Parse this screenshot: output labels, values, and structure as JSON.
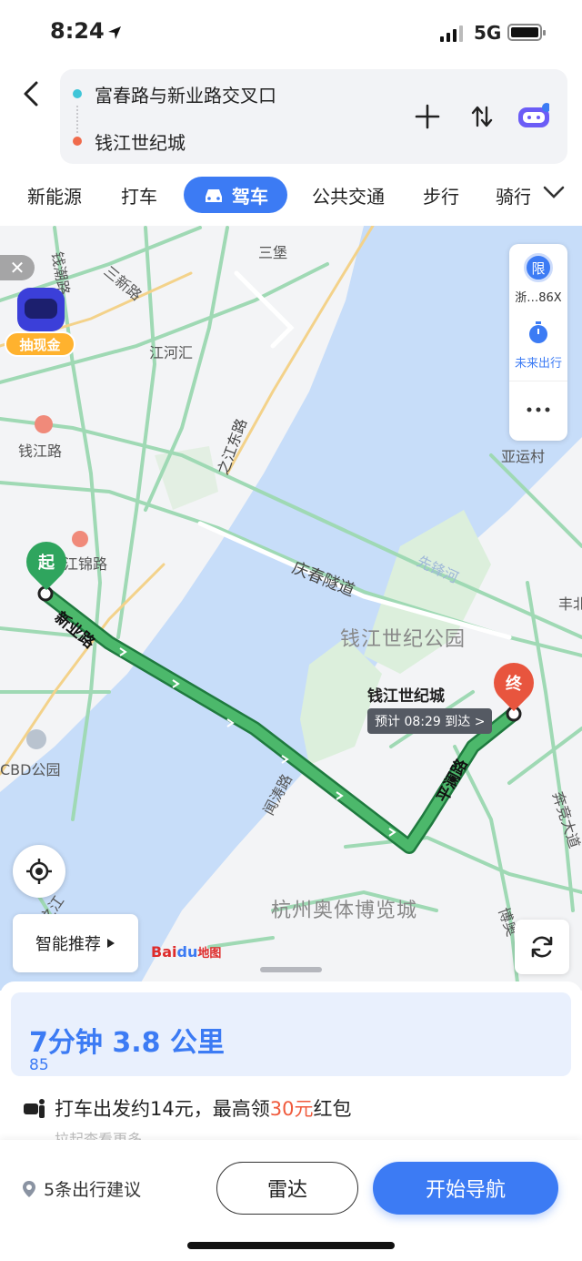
{
  "status_bar": {
    "time": "8:24",
    "network": "5G"
  },
  "route": {
    "from": "富春路与新业路交叉口",
    "to": "钱江世纪城"
  },
  "tabs": [
    "新能源",
    "打车",
    "驾车",
    "公共交通",
    "步行",
    "骑行"
  ],
  "map": {
    "labels": {
      "sanbao": "三堡",
      "sanxin": "三新路",
      "qianchao": "钱潮路",
      "jianghehui": "江河汇",
      "qianjianglu": "钱江路",
      "zhijiangdonglu": "之江东路",
      "yayuncun": "亚运村",
      "jinjinlu": "江锦路",
      "qingchun_tunnel": "庆春隧道",
      "xianfenghe": "先锋河",
      "park": "钱江世纪公园",
      "cbd_park": "CBD公园",
      "wentaolu": "闻涛路",
      "expo": "杭州奥体博览城",
      "fengbei": "丰北",
      "qingyundadao": "奔竞大道",
      "bowen": "博奥",
      "xinyelu": "新业路",
      "pinglanlu": "平澜路",
      "zhi": "之江"
    },
    "start_label": "起",
    "end_label": "终",
    "destination": "钱江世纪城",
    "eta": "预计 08:29 到达 >",
    "plate": "浙…86X",
    "limit": "限",
    "future_label": "未来出行",
    "promo_badge": "抽现金",
    "smart_recommend": "智能推荐",
    "baidu_text": "Bai",
    "baidu_du": "du",
    "baidu_map": "地图"
  },
  "sheet": {
    "summary": "7分钟   3.8 公里",
    "lights": "5",
    "taxi_prefix": "打车出发约14元，最高领",
    "taxi_amount": "30元",
    "taxi_suffix": "红包",
    "more_hint": "拉起查看更多"
  },
  "bottom": {
    "suggest": "5条出行建议",
    "radar": "雷达",
    "navigate": "开始导航"
  },
  "colors": {
    "accent": "#3c7bf4",
    "route": "#4cb86b",
    "start": "#2fa55e",
    "end": "#e8553e",
    "river": "#c7ddf9"
  }
}
